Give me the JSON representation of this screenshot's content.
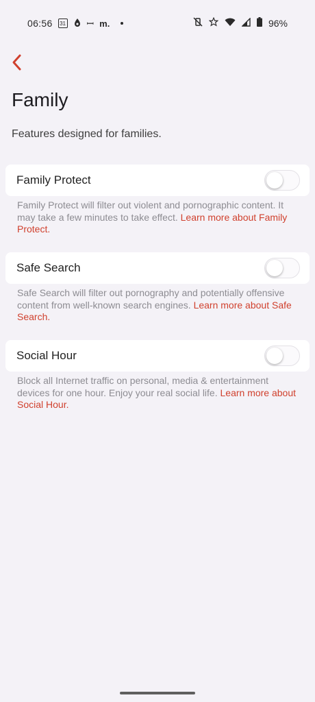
{
  "status_bar": {
    "time": "06:56",
    "calendar_day": "31",
    "misc_glyph_1": "ꟷ",
    "misc_text": "m.",
    "battery_percent": "96%"
  },
  "header": {
    "title": "Family",
    "subtitle": "Features designed for families."
  },
  "colors": {
    "accent": "#d0402d",
    "background": "#f4f2f7",
    "card": "#ffffff"
  },
  "settings": [
    {
      "label": "Family Protect",
      "enabled": false,
      "description": "Family Protect will filter out violent and pornographic content. It may take a few minutes to take effect.",
      "link": "Learn more about Family Protect."
    },
    {
      "label": "Safe Search",
      "enabled": false,
      "description": "Safe Search will filter out pornography and potentially offensive content from well-known search engines.",
      "link": "Learn more about Safe Search."
    },
    {
      "label": "Social Hour",
      "enabled": false,
      "description": "Block all Internet traffic on personal, media & entertainment devices for one hour. Enjoy your real social life.",
      "link": "Learn more about Social Hour."
    }
  ]
}
